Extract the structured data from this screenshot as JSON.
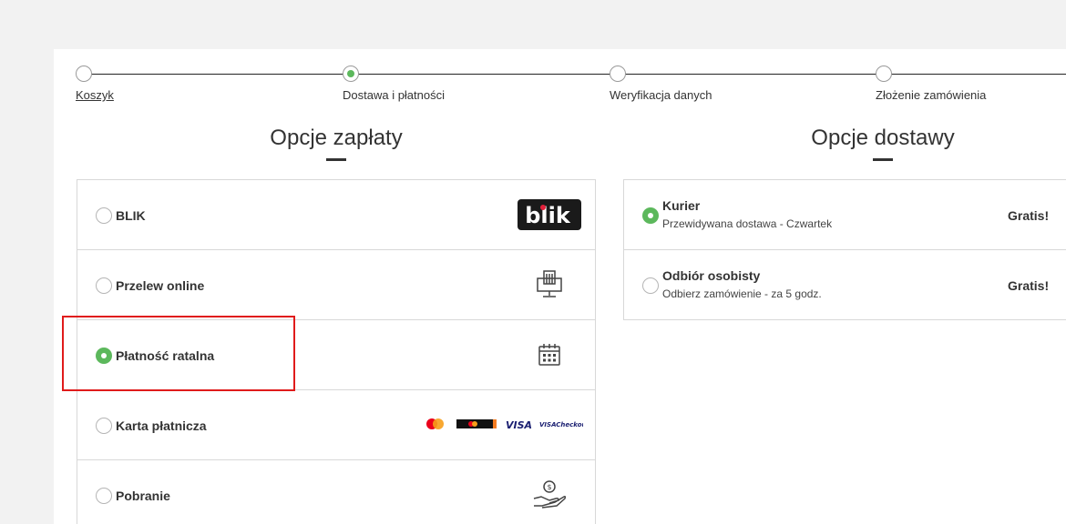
{
  "steps": [
    {
      "label": "Koszyk",
      "active": false,
      "link": true
    },
    {
      "label": "Dostawa i płatności",
      "active": true,
      "link": false
    },
    {
      "label": "Weryfikacja danych",
      "active": false,
      "link": false
    },
    {
      "label": "Złożenie zamówienia",
      "active": false,
      "link": false
    }
  ],
  "payment": {
    "title": "Opcje zapłaty",
    "options": [
      {
        "label": "BLIK",
        "checked": false,
        "icon": "blik-logo"
      },
      {
        "label": "Przelew online",
        "checked": false,
        "icon": "bank-icon"
      },
      {
        "label": "Płatność ratalna",
        "checked": true,
        "icon": "calendar-icon"
      },
      {
        "label": "Karta płatnicza",
        "checked": false,
        "icon": "card-brands"
      },
      {
        "label": "Pobranie",
        "checked": false,
        "icon": "cash-hand-icon"
      }
    ],
    "blik_text": "blik",
    "visa_text": "VISA",
    "visa_checkout_text": "VISACheckout"
  },
  "delivery": {
    "title": "Opcje dostawy",
    "options": [
      {
        "label": "Kurier",
        "sub": "Przewidywana dostawa - Czwartek",
        "price": "Gratis!",
        "checked": true
      },
      {
        "label": "Odbiór osobisty",
        "sub": "Odbierz zamówienie - za 5 godz.",
        "price": "Gratis!",
        "checked": false
      }
    ]
  },
  "colors": {
    "accent": "#5cb85c",
    "highlight": "#e01b1b"
  }
}
